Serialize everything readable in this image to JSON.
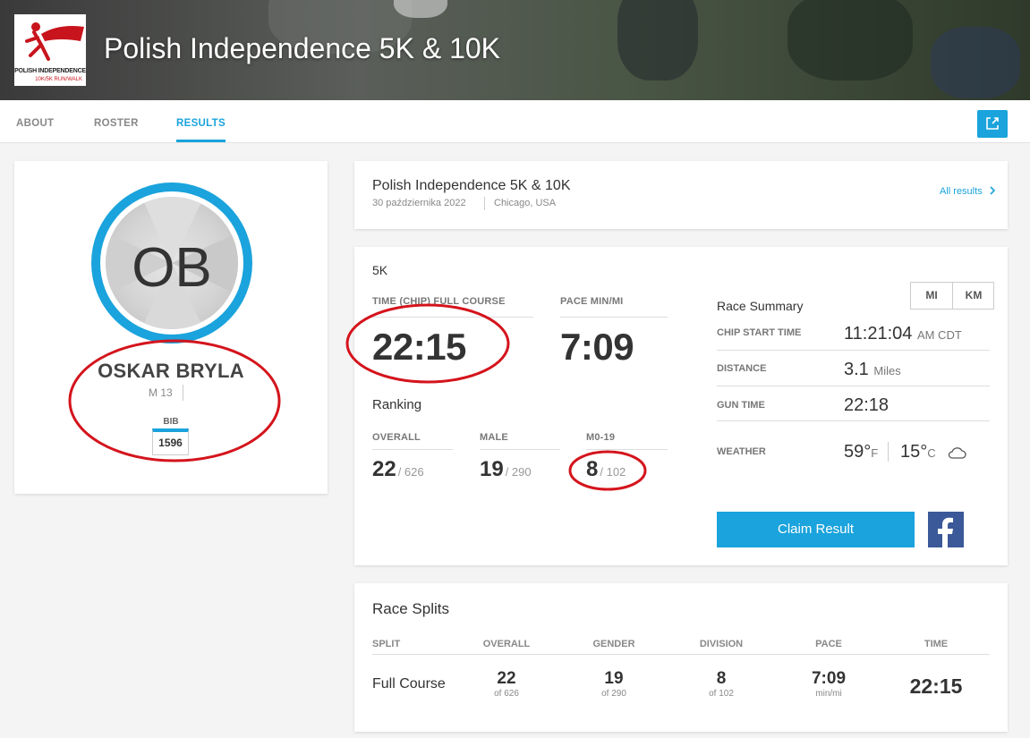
{
  "hero": {
    "title": "Polish Independence 5K & 10K",
    "logo_line1": "POLISH INDEPENDENCE",
    "logo_line2": "10K/5K RUN/WALK"
  },
  "nav": {
    "tabs": [
      {
        "label": "ABOUT",
        "active": false
      },
      {
        "label": "ROSTER",
        "active": false
      },
      {
        "label": "RESULTS",
        "active": true
      }
    ],
    "share_icon": "share-icon"
  },
  "profile": {
    "initials": "OB",
    "name": "OSKAR BRYLA",
    "gender_age": "M 13",
    "bib_label": "BIB",
    "bib": "1596"
  },
  "event": {
    "title": "Polish Independence 5K & 10K",
    "date": "30 października 2022",
    "location": "Chicago, USA",
    "all_results": "All results"
  },
  "result": {
    "race": "5K",
    "time_label": "TIME (CHIP) FULL COURSE",
    "time": "22:15",
    "pace_label": "PACE MIN/MI",
    "pace": "7:09",
    "ranking_title": "Ranking",
    "rankings": [
      {
        "label": "OVERALL",
        "value": "22",
        "total": "/ 626"
      },
      {
        "label": "MALE",
        "value": "19",
        "total": "/ 290"
      },
      {
        "label": "M0-19",
        "value": "8",
        "total": "/ 102"
      }
    ],
    "units": [
      "MI",
      "KM"
    ],
    "summary_title": "Race Summary",
    "chip_start_label": "CHIP START TIME",
    "chip_start_value": "11:21:04",
    "chip_start_unit": "AM CDT",
    "distance_label": "DISTANCE",
    "distance_value": "3.1",
    "distance_unit": "Miles",
    "gun_time_label": "GUN TIME",
    "gun_time_value": "22:18",
    "weather_label": "WEATHER",
    "temp_f": "59°",
    "temp_f_unit": "F",
    "temp_c": "15°",
    "temp_c_unit": "C",
    "weather_icon": "cloud-icon",
    "claim_label": "Claim Result",
    "facebook_icon": "facebook-icon"
  },
  "splits": {
    "title": "Race Splits",
    "headers": [
      "SPLIT",
      "OVERALL",
      "GENDER",
      "DIVISION",
      "PACE",
      "TIME"
    ],
    "row": {
      "split": "Full Course",
      "overall": "22",
      "overall_sub": "of 626",
      "gender": "19",
      "gender_sub": "of 290",
      "division": "8",
      "division_sub": "of 102",
      "pace": "7:09",
      "pace_sub": "min/mi",
      "time": "22:15"
    }
  },
  "colors": {
    "accent": "#1aa3dc",
    "facebook": "#3b5998",
    "annotation": "#d4141c"
  }
}
